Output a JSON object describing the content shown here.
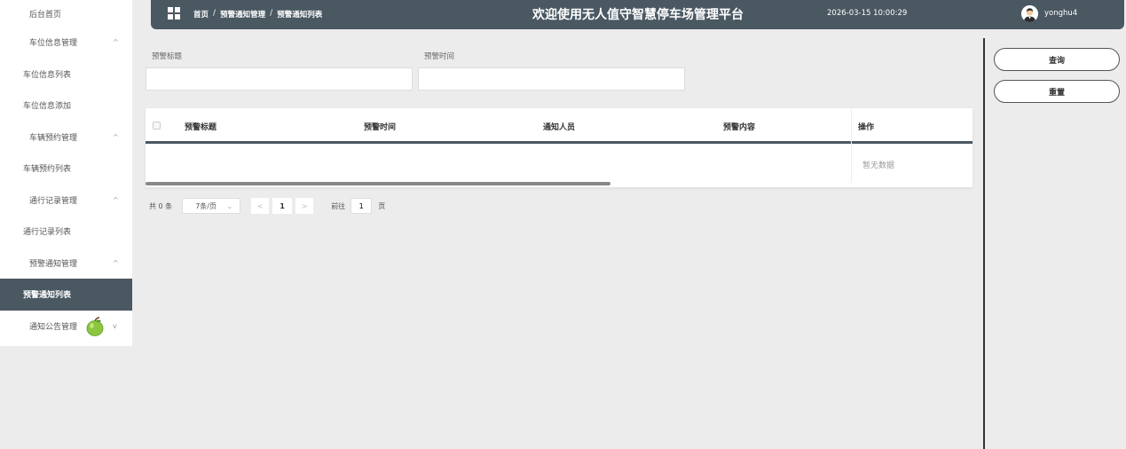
{
  "sidebar": {
    "home": "后台首页",
    "items": [
      {
        "label": "车位信息管理",
        "type": "group",
        "caret": "^"
      },
      {
        "label": "车位信息列表",
        "type": "item"
      },
      {
        "label": "车位信息添加",
        "type": "item"
      },
      {
        "label": "车辆预约管理",
        "type": "group",
        "caret": "^"
      },
      {
        "label": "车辆预约列表",
        "type": "item"
      },
      {
        "label": "通行记录管理",
        "type": "group",
        "caret": "^"
      },
      {
        "label": "通行记录列表",
        "type": "item"
      },
      {
        "label": "预警通知管理",
        "type": "group",
        "caret": "^"
      },
      {
        "label": "预警通知列表",
        "type": "item",
        "active": true
      },
      {
        "label": "通知公告管理",
        "type": "group",
        "caret": "v"
      }
    ]
  },
  "header": {
    "breadcrumb": [
      "首页",
      "预警通知管理",
      "预警通知列表"
    ],
    "separator": "/",
    "title": "欢迎使用无人值守智慧停车场管理平台",
    "datetime": "2026-03-15 10:00:29",
    "username": "yonghu4",
    "bg_color": "#4a5862"
  },
  "search": {
    "title_label": "预警标题",
    "title_value": "",
    "time_label": "预警时间",
    "time_value": ""
  },
  "actions": {
    "query": "查询",
    "reset": "重置"
  },
  "table": {
    "columns": [
      "预警标题",
      "预警时间",
      "通知人员",
      "预警内容",
      "操作"
    ],
    "empty_text": "暂无数据"
  },
  "pagination": {
    "total_text": "共 0 条",
    "page_size": "7条/页",
    "prev": "<",
    "current_page": "1",
    "next": ">",
    "goto_label": "前往",
    "goto_value": "1",
    "goto_suffix": "页"
  }
}
